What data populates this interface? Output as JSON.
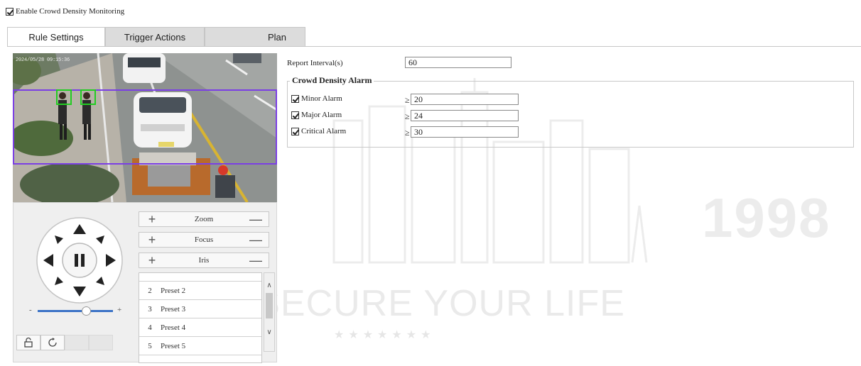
{
  "header": {
    "enable_label": "Enable Crowd Density Monitoring",
    "enable_checked": true
  },
  "tabs": [
    {
      "label": "Rule Settings",
      "active": true
    },
    {
      "label": "Trigger Actions",
      "active": false
    },
    {
      "label": "Plan",
      "active": false
    }
  ],
  "video": {
    "osd_text": "2024/05/28 09:15:36"
  },
  "ptz": {
    "lens": [
      {
        "label": "Zoom"
      },
      {
        "label": "Focus"
      },
      {
        "label": "Iris"
      }
    ],
    "plus": "+",
    "minus": "—",
    "speed_minus": "-",
    "speed_plus": "+",
    "presets": [
      {
        "num": "2",
        "name": "Preset 2"
      },
      {
        "num": "3",
        "name": "Preset 3"
      },
      {
        "num": "4",
        "name": "Preset 4"
      },
      {
        "num": "5",
        "name": "Preset 5"
      }
    ]
  },
  "settings": {
    "report_interval_label": "Report Interval(s)",
    "report_interval_value": "60",
    "alarm_group_title": "Crowd Density Alarm",
    "ge_symbol": "≥",
    "alarms": [
      {
        "label": "Minor Alarm",
        "checked": true,
        "value": "20"
      },
      {
        "label": "Major Alarm",
        "checked": true,
        "value": "24"
      },
      {
        "label": "Critical Alarm",
        "checked": true,
        "value": "30"
      }
    ]
  },
  "watermark": {
    "year": "1998",
    "slogan": "WE SECURE YOUR LIFE",
    "stars": "★★★★★★★"
  },
  "colors": {
    "detection_box": "#7b3fe4",
    "person_box": "#22cc22",
    "tab_inactive": "#dcdcdc"
  }
}
